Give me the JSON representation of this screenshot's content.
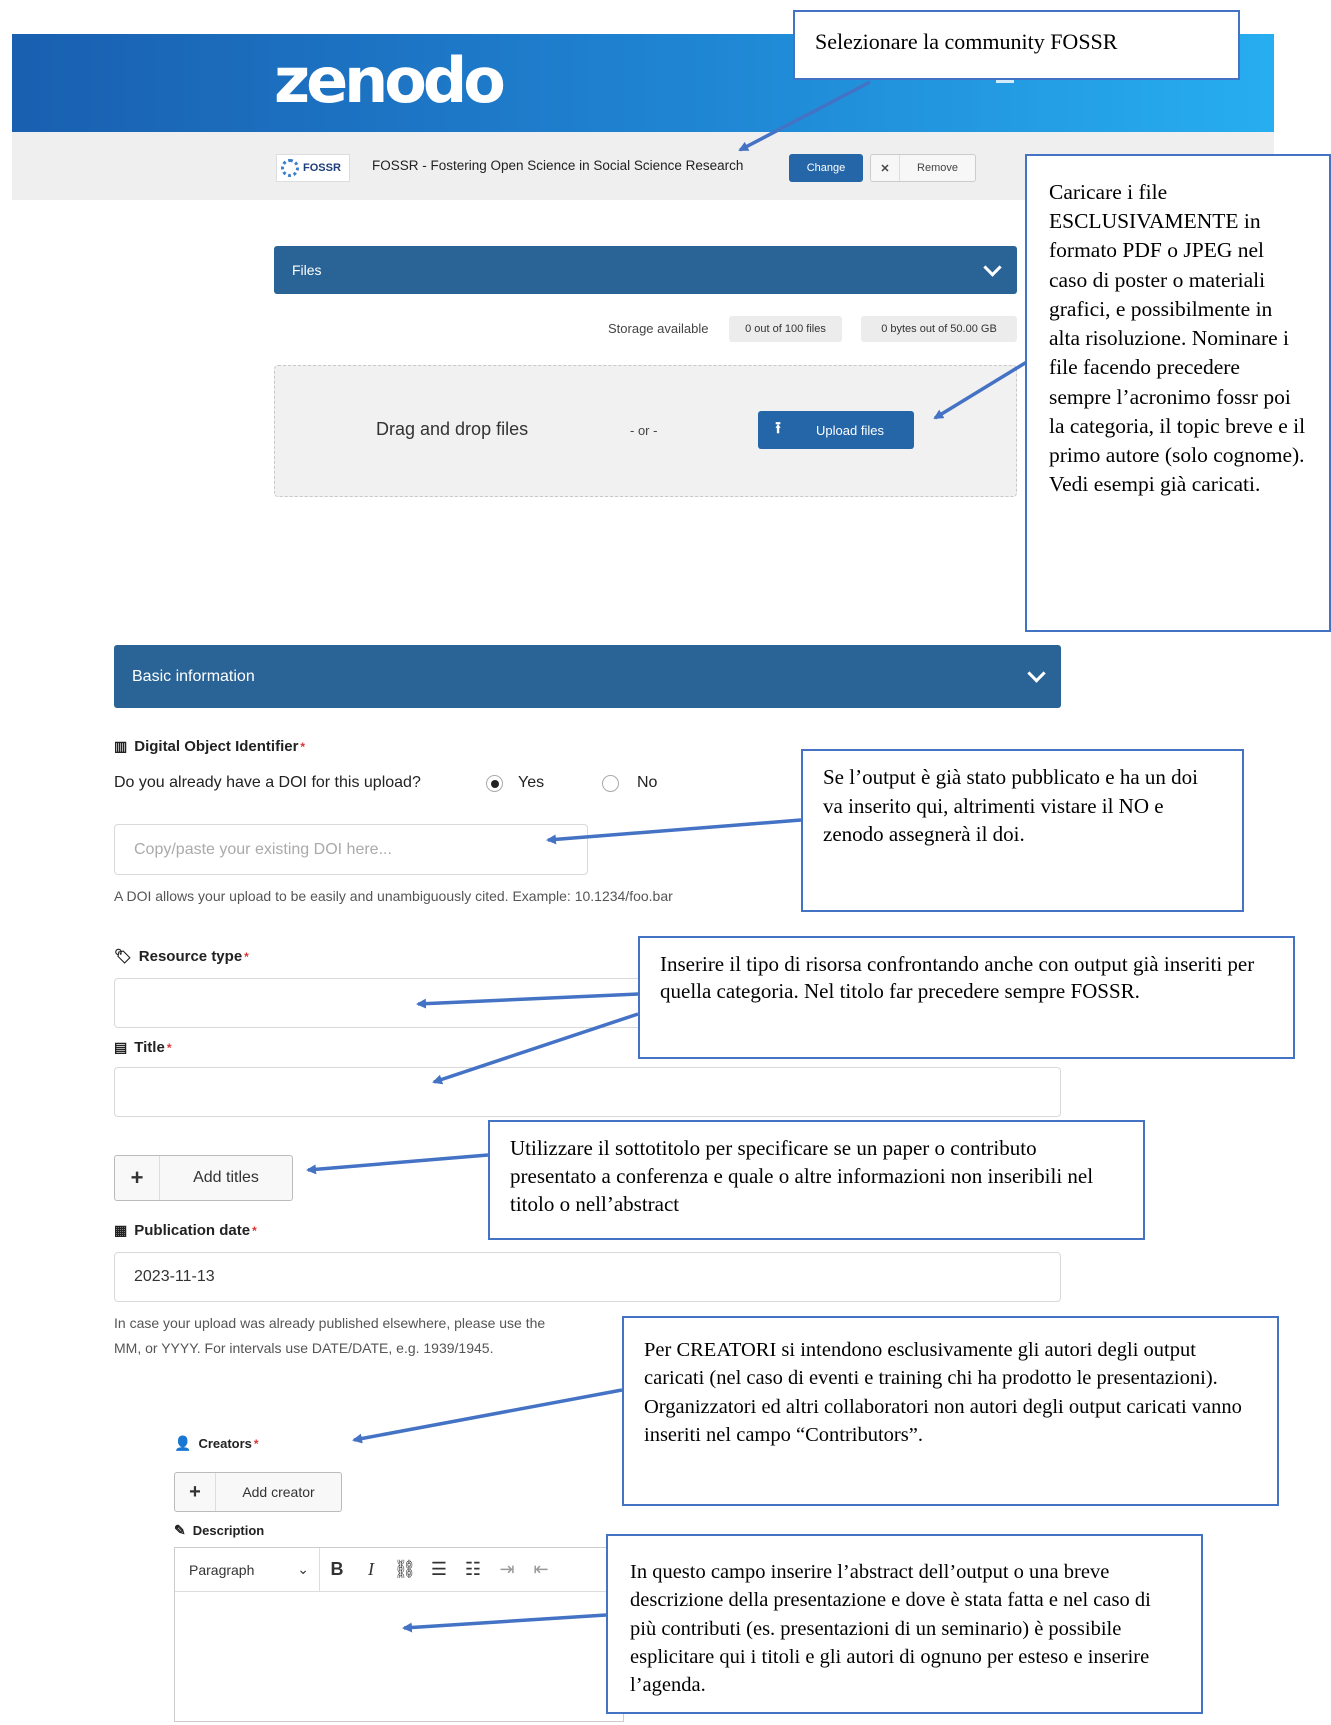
{
  "header": {
    "logo_text": "zenodo"
  },
  "community": {
    "logo_text": "FOSSR",
    "title": "FOSSR - Fostering Open Science in Social Science Research",
    "change_label": "Change",
    "remove_label": "Remove"
  },
  "files": {
    "section_label": "Files",
    "storage_label": "Storage available",
    "files_count": "0 out of 100 files",
    "bytes_count": "0 bytes out of 50.00 GB",
    "dropzone_text": "Drag and drop files",
    "or_text": "- or -",
    "upload_label": "Upload files"
  },
  "basic": {
    "section_label": "Basic information",
    "doi_label": "Digital Object Identifier",
    "doi_question": "Do you already have a DOI for this upload?",
    "yes_label": "Yes",
    "no_label": "No",
    "doi_placeholder": "Copy/paste your existing DOI here...",
    "doi_help": "A DOI allows your upload to be easily and unambiguously cited. Example: 10.1234/foo.bar",
    "resource_type_label": "Resource type",
    "title_label": "Title",
    "add_titles_label": "Add titles",
    "publication_date_label": "Publication date",
    "publication_date_value": "2023-11-13",
    "pd_help_line1": "In case your upload was already published elsewhere, please use the",
    "pd_help_line2": "MM, or YYYY. For intervals use DATE/DATE, e.g. 1939/1945.",
    "creators_label": "Creators",
    "add_creator_label": "Add creator",
    "description_label": "Description",
    "paragraph_label": "Paragraph",
    "required_mark": "*"
  },
  "callouts": {
    "c1": "Selezionare la community FOSSR",
    "c2": "Caricare i file ESCLUSIVAMENTE in formato PDF o JPEG nel caso di poster o materiali grafici, e possibilmente in alta risoluzione. Nominare i file facendo precedere sempre l’acronimo fossr poi la categoria, il topic breve e il primo autore (solo cognome). Vedi esempi già caricati.",
    "c3": "Se l’output è già stato pubblicato e ha un doi va inserito qui, altrimenti vistare il NO e zenodo assegnerà il doi.",
    "c4": "Inserire il tipo di risorsa confrontando anche con output già inseriti per quella categoria. Nel titolo far precedere sempre FOSSR.",
    "c5": "Utilizzare il sottotitolo per specificare se un paper o contributo presentato a conferenza e quale o altre informazioni non inseribili nel titolo o nell’abstract",
    "c6": "Per CREATORI si intendono esclusivamente gli autori degli output caricati (nel caso di eventi e training chi ha prodotto le presentazioni). Organizzatori ed altri collaboratori non autori degli output caricati vanno inseriti nel campo “Contributors”.",
    "c7": "In questo campo inserire l’abstract dell’output o una breve descrizione della presentazione e dove è stata fatta e nel caso di più contributi (es. presentazioni di un seminario) è possibile esplicitare qui i titoli e gli autori di ognuno per esteso e inserire l’agenda."
  },
  "colors": {
    "accent": "#2a6496",
    "callout_border": "#4472c4",
    "header_start": "#1a5fb0",
    "header_end": "#27aef0"
  }
}
